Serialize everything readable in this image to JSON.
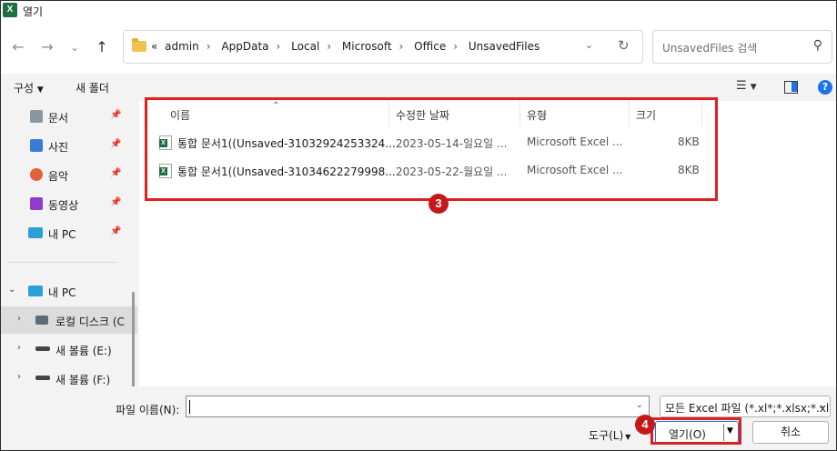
{
  "window": {
    "title": "열기",
    "app_icon": "X"
  },
  "nav": {
    "back": "←",
    "forward": "→",
    "recent": "⌄",
    "up": "↑",
    "breadcrumb_prefix": "«",
    "breadcrumbs": [
      "admin",
      "AppData",
      "Local",
      "Microsoft",
      "Office",
      "UnsavedFiles"
    ],
    "search_placeholder": "UnsavedFiles 검색"
  },
  "commandbar": {
    "organize": "구성",
    "new_folder": "새 폴더"
  },
  "sidebar": {
    "quick": [
      {
        "label": "문서",
        "icon": "documents-icon"
      },
      {
        "label": "사진",
        "icon": "pictures-icon"
      },
      {
        "label": "음악",
        "icon": "music-icon"
      },
      {
        "label": "동영상",
        "icon": "videos-icon"
      },
      {
        "label": "내 PC",
        "icon": "pc-icon"
      }
    ],
    "tree": [
      {
        "label": "내 PC",
        "expanded": true
      },
      {
        "label": "로컬 디스크 (C",
        "selected": true
      },
      {
        "label": "새 볼륨 (E:)"
      },
      {
        "label": "새 볼륨 (F:)"
      }
    ]
  },
  "columns": {
    "name": "이름",
    "modified": "수정한 날짜",
    "type": "유형",
    "size": "크기"
  },
  "files": [
    {
      "name": "통합 문서1((Unsaved-31032924253324...",
      "modified": "2023-05-14-일요일 ...",
      "type": "Microsoft Excel ...",
      "size": "8KB"
    },
    {
      "name": "통합 문서1((Unsaved-31034622279998...",
      "modified": "2023-05-22-월요일 ...",
      "type": "Microsoft Excel ...",
      "size": "8KB"
    }
  ],
  "annotations": {
    "files_badge": "3",
    "open_badge": "4",
    "color": "#e02020"
  },
  "bottom": {
    "filename_label": "파일 이름(N):",
    "filename_value": "",
    "filter": "모든 Excel 파일 (*.xl*;*.xlsx;*.xl",
    "tools": "도구(L)",
    "open": "열기(O)",
    "cancel": "취소"
  }
}
